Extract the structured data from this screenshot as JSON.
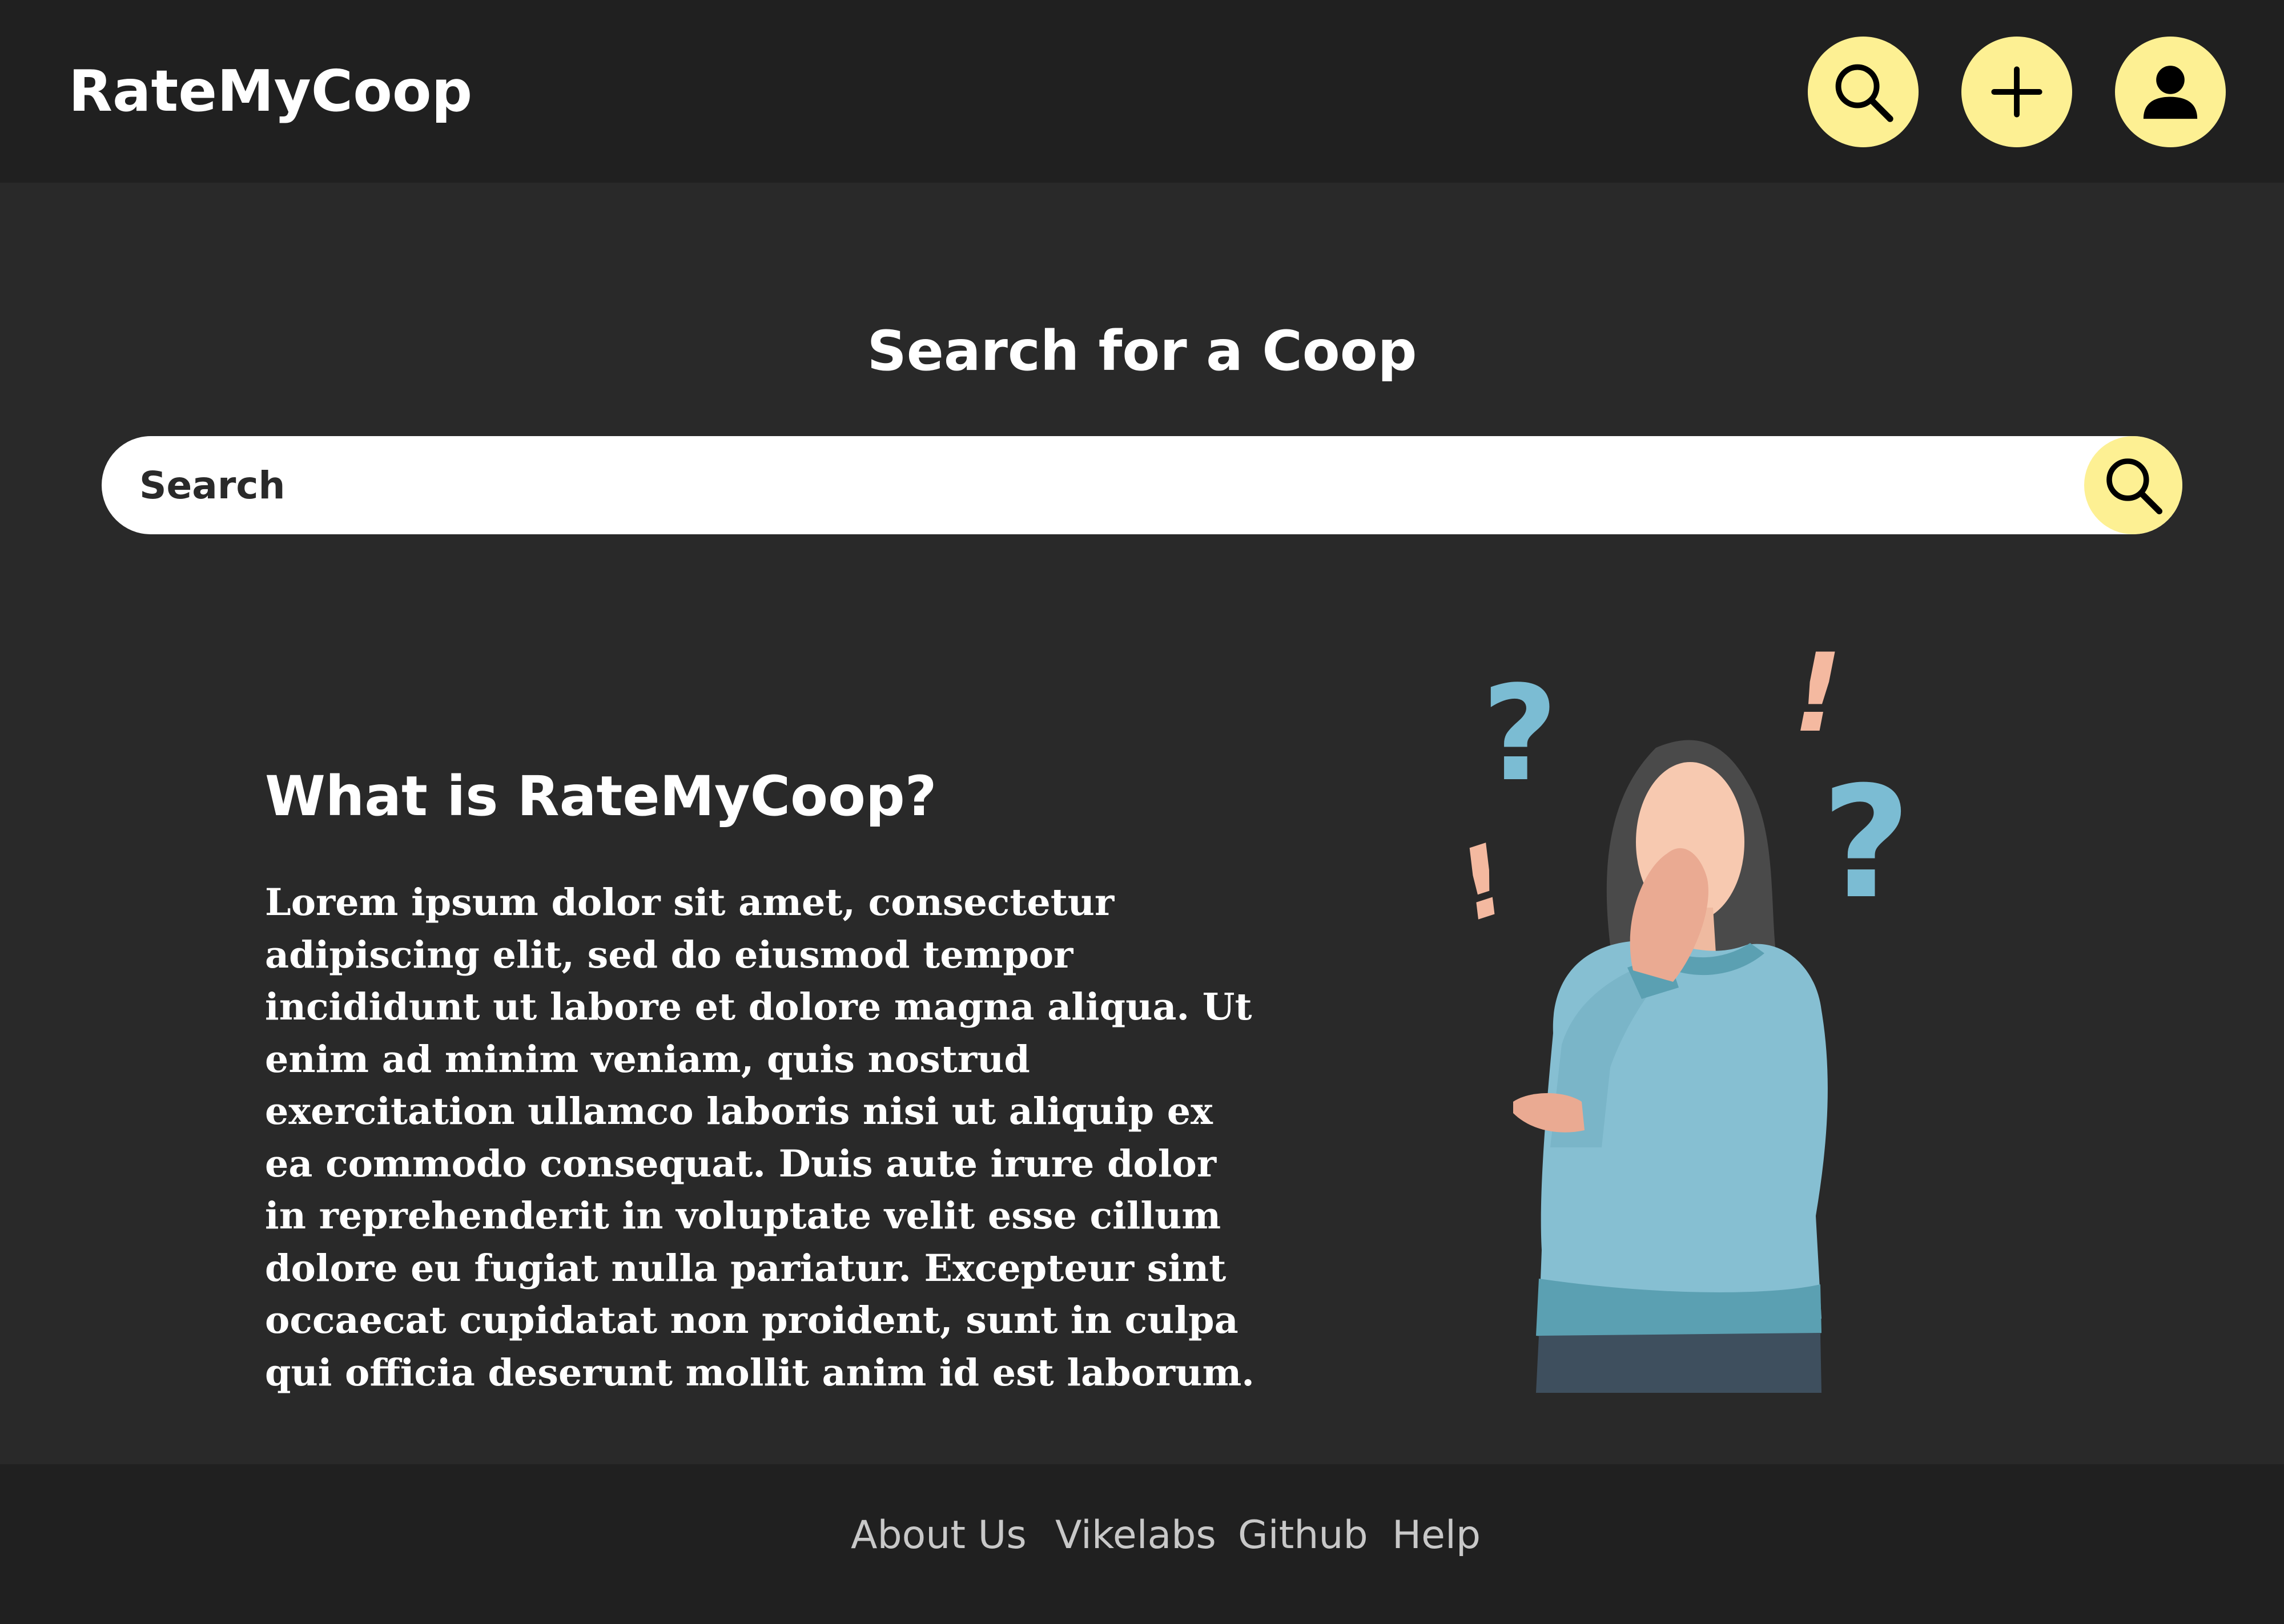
{
  "header": {
    "brand": "RateMyCoop",
    "nav_icons": [
      "search-icon",
      "plus-icon",
      "user-icon"
    ]
  },
  "search": {
    "title": "Search for a Coop",
    "placeholder": "Search",
    "submit_icon": "search-icon"
  },
  "about": {
    "heading": "What is RateMyCoop?",
    "body": "Lorem ipsum dolor sit amet, consectetur adipiscing elit, sed do eiusmod tempor incididunt ut labore et dolore magna aliqua. Ut enim ad minim veniam, quis nostrud exercitation ullamco laboris nisi ut aliquip ex ea commodo consequat. Duis aute irure dolor in reprehenderit in voluptate velit esse cillum dolore eu fugiat nulla pariatur. Excepteur sint occaecat cupidatat non proident, sunt in culpa qui officia deserunt mollit anim id est laborum.",
    "illustration": "confused-person-illustration"
  },
  "footer": {
    "links": [
      "About Us",
      "Vikelabs",
      "Github",
      "Help"
    ]
  },
  "colors": {
    "background": "#292929",
    "bar": "#202020",
    "accent": "#fdf093",
    "text": "#ffffff",
    "footer_text": "#c8c8c8"
  }
}
